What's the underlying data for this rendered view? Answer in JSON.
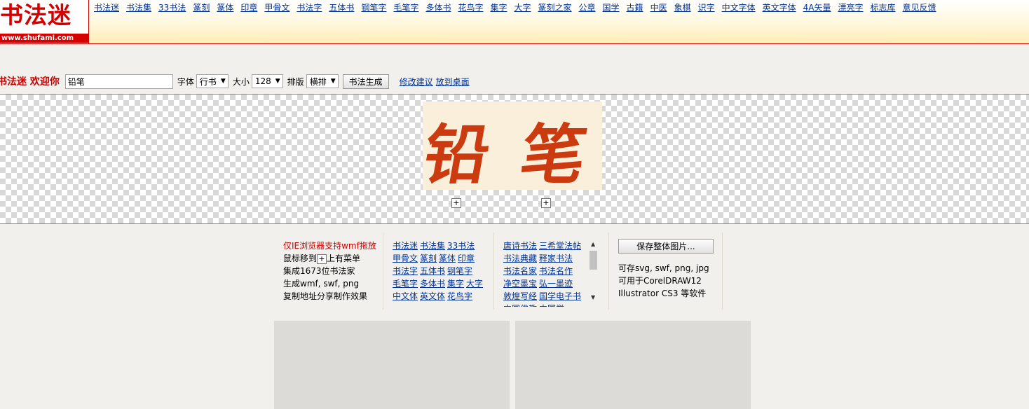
{
  "logo": {
    "text": "书法迷",
    "url": "www.shufami.com"
  },
  "nav": [
    "书法迷",
    "书法集",
    "33书法",
    "篆刻",
    "篆体",
    "印章",
    "甲骨文",
    "书法字",
    "五体书",
    "钢笔字",
    "毛笔字",
    "多体书",
    "花鸟字",
    "集字",
    "大字",
    "篆刻之家",
    "公章",
    "国学",
    "古籍",
    "中医",
    "象棋",
    "识字",
    "中文字体",
    "英文字体",
    "4A矢量",
    "漂亮字",
    "标志库",
    "意见反馈"
  ],
  "toolbar": {
    "welcome": "书法迷 欢迎你",
    "input_value": "铅笔",
    "font_label": "字体",
    "font_value": "行书",
    "size_label": "大小",
    "size_value": "128",
    "layout_label": "排版",
    "layout_value": "横排",
    "generate_label": "书法生成",
    "suggest_link": "修改建议",
    "desktop_link": "放到桌面"
  },
  "preview": {
    "chars": [
      "铅",
      "笔"
    ],
    "ink_color": "#cc3a10",
    "plus": "+"
  },
  "info": {
    "ie_note": "仅IE浏览器支持wmf拖放",
    "menu_pre": "鼠标移到",
    "menu_post": "上有菜单",
    "count": "集成1673位书法家",
    "formats": "生成wmf, swf, png",
    "share": "复制地址分享制作效果"
  },
  "links_grid": [
    [
      "书法迷",
      "书法集",
      "33书法"
    ],
    [
      "甲骨文",
      "篆刻",
      "篆体",
      "印章"
    ],
    [
      "书法字",
      "五体书",
      "钢笔字"
    ],
    [
      "毛笔字",
      "多体书",
      "集字",
      "大字"
    ],
    [
      "中文体",
      "英文体",
      "花鸟字"
    ]
  ],
  "scroll_links": [
    [
      "唐诗书法",
      "三希堂法帖"
    ],
    [
      "书法典藏",
      "释家书法"
    ],
    [
      "书法名家",
      "书法名作"
    ],
    [
      "净空墨宝",
      "弘一墨迹"
    ],
    [
      "敦煌写经",
      "国学电子书"
    ],
    [
      "中国佛教",
      "中国学"
    ]
  ],
  "save": {
    "button": "保存整体图片...",
    "lines": [
      "可存svg, swf, png, jpg",
      "可用于CorelDRAW12",
      "Illustrator CS3 等软件"
    ]
  }
}
